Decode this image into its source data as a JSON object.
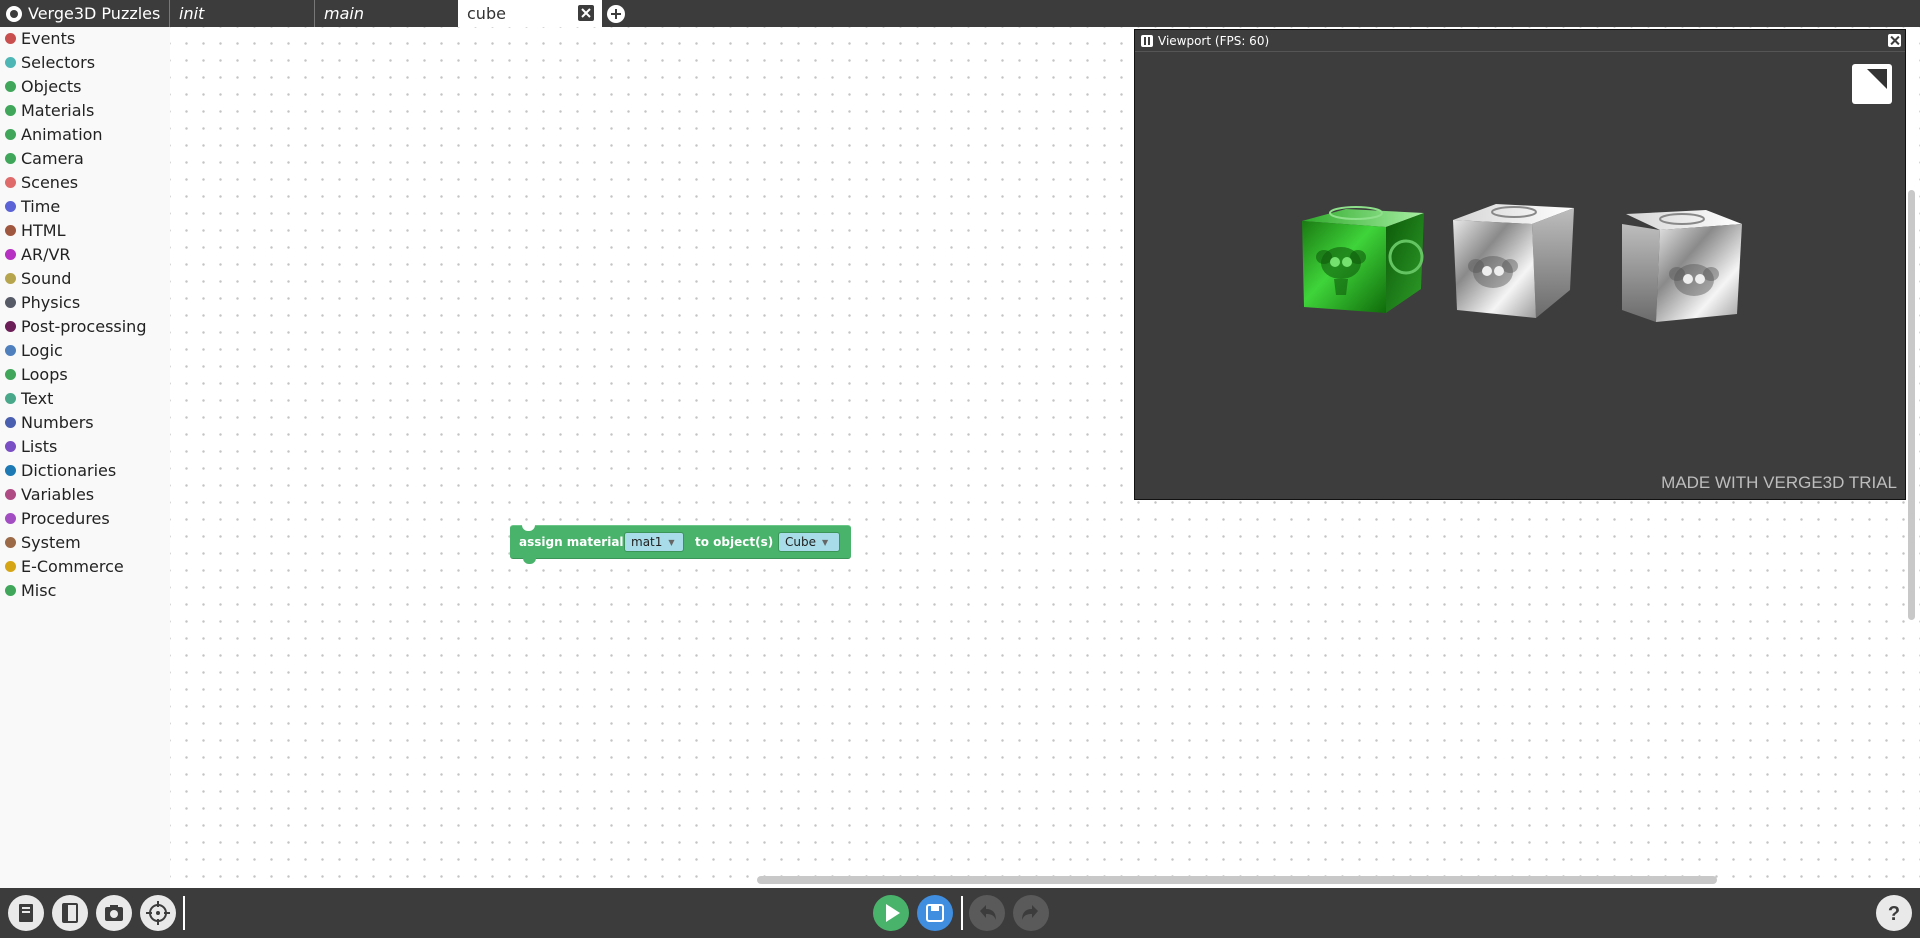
{
  "app": {
    "title": "Verge3D Puzzles"
  },
  "tabs": [
    {
      "label": "init",
      "active": false
    },
    {
      "label": "main",
      "active": false
    },
    {
      "label": "cube",
      "active": true
    }
  ],
  "toolbox": [
    {
      "label": "Events",
      "color": "#c94f4f"
    },
    {
      "label": "Selectors",
      "color": "#4fb6b6"
    },
    {
      "label": "Objects",
      "color": "#3fa65a"
    },
    {
      "label": "Materials",
      "color": "#3fa65a"
    },
    {
      "label": "Animation",
      "color": "#3fa65a"
    },
    {
      "label": "Camera",
      "color": "#3fa65a"
    },
    {
      "label": "Scenes",
      "color": "#e06b6b"
    },
    {
      "label": "Time",
      "color": "#5b63d6"
    },
    {
      "label": "HTML",
      "color": "#a0573f"
    },
    {
      "label": "AR/VR",
      "color": "#b630c2"
    },
    {
      "label": "Sound",
      "color": "#b7a54e"
    },
    {
      "label": "Physics",
      "color": "#555a66"
    },
    {
      "label": "Post-processing",
      "color": "#6b1e57"
    },
    {
      "label": "Logic",
      "color": "#4f80bd"
    },
    {
      "label": "Loops",
      "color": "#3fa65a"
    },
    {
      "label": "Text",
      "color": "#49a88a"
    },
    {
      "label": "Numbers",
      "color": "#4a5fb0"
    },
    {
      "label": "Lists",
      "color": "#7a4ec4"
    },
    {
      "label": "Dictionaries",
      "color": "#1d79b3"
    },
    {
      "label": "Variables",
      "color": "#b04a85"
    },
    {
      "label": "Procedures",
      "color": "#a24ec2"
    },
    {
      "label": "System",
      "color": "#9c6a46"
    },
    {
      "label": "E-Commerce",
      "color": "#d6a516"
    },
    {
      "label": "Misc",
      "color": "#3fa65a"
    }
  ],
  "block": {
    "label": "assign material",
    "material": "mat1",
    "to_label": "to object(s)",
    "object": "Cube",
    "color": "#49b36b"
  },
  "viewport": {
    "title": "Viewport (FPS: 60)",
    "watermark": "MADE WITH VERGE3D TRIAL"
  },
  "bottombar": {
    "left_icons": [
      "manual-icon",
      "save-file-icon",
      "screenshot-icon",
      "center-view-icon"
    ],
    "center_icons": [
      "play-icon",
      "save-icon",
      "undo-icon",
      "redo-icon"
    ],
    "right_icons": [
      "help-icon"
    ],
    "colors": {
      "play": "#49b36b",
      "save": "#3f8ee0",
      "disabled": "#5a5a5a"
    }
  }
}
